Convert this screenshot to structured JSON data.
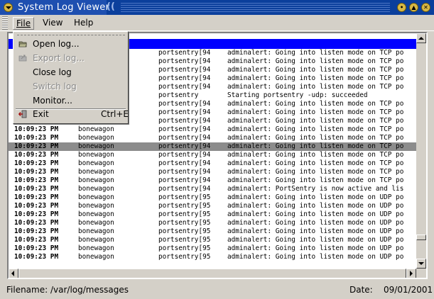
{
  "window": {
    "title": "System Log Viewer"
  },
  "menubar": {
    "file": "File",
    "view": "View",
    "help": "Help"
  },
  "file_menu": {
    "open": "Open log...",
    "export": "Export log...",
    "close": "Close log",
    "switch": "Switch log",
    "monitor": "Monitor...",
    "exit": "Exit",
    "exit_shortcut": "Ctrl+E"
  },
  "log": {
    "rows": [
      {
        "time": "",
        "host": "",
        "proc": "",
        "msg": "",
        "style": "blue"
      },
      {
        "time": "",
        "host": "",
        "proc": "portsentry[94",
        "msg": "adminalert: Going into listen mode on TCP po"
      },
      {
        "time": "",
        "host": "",
        "proc": "portsentry[94",
        "msg": "adminalert: Going into listen mode on TCP po"
      },
      {
        "time": "",
        "host": "",
        "proc": "portsentry[94",
        "msg": "adminalert: Going into listen mode on TCP po"
      },
      {
        "time": "",
        "host": "",
        "proc": "portsentry[94",
        "msg": "adminalert: Going into listen mode on TCP po"
      },
      {
        "time": "",
        "host": "",
        "proc": "portsentry[94",
        "msg": "adminalert: Going into listen mode on TCP po"
      },
      {
        "time": "",
        "host": "",
        "proc": "portsentry",
        "msg": "Starting portsentry -udp:  succeeded"
      },
      {
        "time": "",
        "host": "",
        "proc": "portsentry[94",
        "msg": "adminalert: Going into listen mode on TCP po"
      },
      {
        "time": "",
        "host": "",
        "proc": "portsentry[94",
        "msg": "adminalert: Going into listen mode on TCP po"
      },
      {
        "time": "10:09:23 PM",
        "host": "bonewagon",
        "proc": "portsentry[94",
        "msg": "adminalert: Going into listen mode on TCP po"
      },
      {
        "time": "10:09:23 PM",
        "host": "bonewagon",
        "proc": "portsentry[94",
        "msg": "adminalert: Going into listen mode on TCP po"
      },
      {
        "time": "10:09:23 PM",
        "host": "bonewagon",
        "proc": "portsentry[94",
        "msg": "adminalert: Going into listen mode on TCP po"
      },
      {
        "time": "10:09:23 PM",
        "host": "bonewagon",
        "proc": "portsentry[94",
        "msg": "adminalert: Going into listen mode on TCP po",
        "style": "sel"
      },
      {
        "time": "10:09:23 PM",
        "host": "bonewagon",
        "proc": "portsentry[94",
        "msg": "adminalert: Going into listen mode on TCP po"
      },
      {
        "time": "10:09:23 PM",
        "host": "bonewagon",
        "proc": "portsentry[94",
        "msg": "adminalert: Going into listen mode on TCP po"
      },
      {
        "time": "10:09:23 PM",
        "host": "bonewagon",
        "proc": "portsentry[94",
        "msg": "adminalert: Going into listen mode on TCP po"
      },
      {
        "time": "10:09:23 PM",
        "host": "bonewagon",
        "proc": "portsentry[94",
        "msg": "adminalert: Going into listen mode on TCP po"
      },
      {
        "time": "10:09:23 PM",
        "host": "bonewagon",
        "proc": "portsentry[94",
        "msg": "adminalert: PortSentry is now active and lis"
      },
      {
        "time": "10:09:23 PM",
        "host": "bonewagon",
        "proc": "portsentry[95",
        "msg": "adminalert: Going into listen mode on UDP po"
      },
      {
        "time": "10:09:23 PM",
        "host": "bonewagon",
        "proc": "portsentry[95",
        "msg": "adminalert: Going into listen mode on UDP po"
      },
      {
        "time": "10:09:23 PM",
        "host": "bonewagon",
        "proc": "portsentry[95",
        "msg": "adminalert: Going into listen mode on UDP po"
      },
      {
        "time": "10:09:23 PM",
        "host": "bonewagon",
        "proc": "portsentry[95",
        "msg": "adminalert: Going into listen mode on UDP po"
      },
      {
        "time": "10:09:23 PM",
        "host": "bonewagon",
        "proc": "portsentry[95",
        "msg": "adminalert: Going into listen mode on UDP po"
      },
      {
        "time": "10:09:23 PM",
        "host": "bonewagon",
        "proc": "portsentry[95",
        "msg": "adminalert: Going into listen mode on UDP po"
      },
      {
        "time": "10:09:23 PM",
        "host": "bonewagon",
        "proc": "portsentry[95",
        "msg": "adminalert: Going into listen mode on UDP po"
      },
      {
        "time": "10:09:23 PM",
        "host": "bonewagon",
        "proc": "portsentry[95",
        "msg": "adminalert: Going into listen mode on UDP po"
      }
    ]
  },
  "status": {
    "filename": "Filename:  /var/log/messages",
    "date_label": "Date:",
    "date": "09/01/2001"
  },
  "icons": {
    "window_menu": "window-menu-icon",
    "minimize": "minimize-icon",
    "maximize": "maximize-icon",
    "close": "close-icon",
    "open": "open-folder-icon",
    "export": "export-icon",
    "exit": "exit-icon"
  },
  "colors": {
    "titlebar": "#0b3f9c",
    "selected_row_blue": "#0000ff",
    "selected_row_gray": "#8c8c8c",
    "window_bg": "#d4d0c8"
  }
}
